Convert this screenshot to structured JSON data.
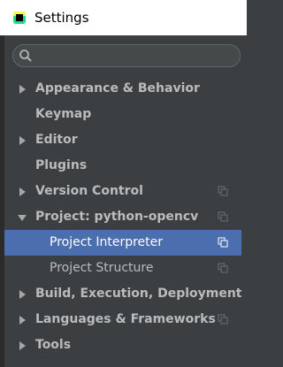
{
  "window": {
    "title": "Settings"
  },
  "search": {
    "placeholder": "",
    "value": ""
  },
  "tree": [
    {
      "label": "Appearance & Behavior",
      "bold": true
    },
    {
      "label": "Keymap",
      "bold": true
    },
    {
      "label": "Editor",
      "bold": true
    },
    {
      "label": "Plugins",
      "bold": true
    },
    {
      "label": "Version Control",
      "bold": true
    },
    {
      "label": "Project: python-opencv",
      "bold": true
    },
    {
      "label": "Project Interpreter",
      "bold": false
    },
    {
      "label": "Project Structure",
      "bold": false
    },
    {
      "label": "Build, Execution, Deployment",
      "bold": true
    },
    {
      "label": "Languages & Frameworks",
      "bold": true
    },
    {
      "label": "Tools",
      "bold": true
    }
  ],
  "colors": {
    "background": "#3c3f41",
    "selection": "#4b6eaf",
    "text": "#bbbbbb",
    "titlebar": "#ffffff"
  }
}
